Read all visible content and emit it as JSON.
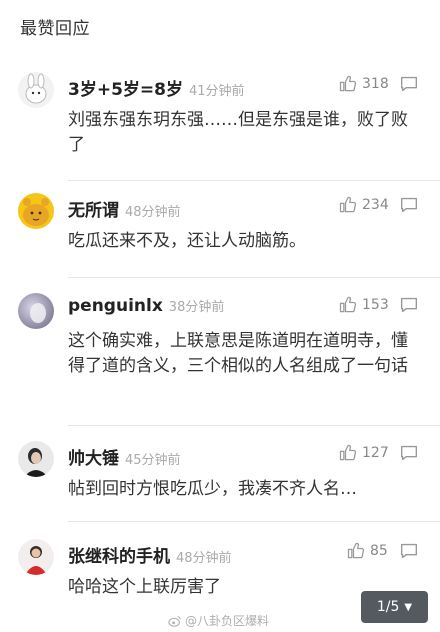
{
  "section": {
    "title": "最赞回应"
  },
  "comments": [
    {
      "name": "3岁+5岁=8岁",
      "time": "41分钟前",
      "likes": "318",
      "text": "刘强东强东玥东强……但是东强是谁，败了败了"
    },
    {
      "name": "无所谓",
      "time": "48分钟前",
      "likes": "234",
      "text": "吃瓜还来不及，还让人动脑筋。"
    },
    {
      "name": "penguinlx",
      "time": "38分钟前",
      "likes": "153",
      "text": "这个确实难，上联意思是陈道明在道明寺，懂得了道的含义，三个相似的人名组成了一句话"
    },
    {
      "name": "帅大锤",
      "time": "45分钟前",
      "likes": "127",
      "text": "帖到回时方恨吃瓜少，我凑不齐人名…"
    },
    {
      "name": "张继科的手机",
      "time": "48分钟前",
      "likes": "85",
      "text": "哈哈这个上联厉害了"
    }
  ],
  "pager": {
    "label": "1/5",
    "caret": "▼"
  },
  "watermark": {
    "text": "@八卦负区爆料"
  }
}
